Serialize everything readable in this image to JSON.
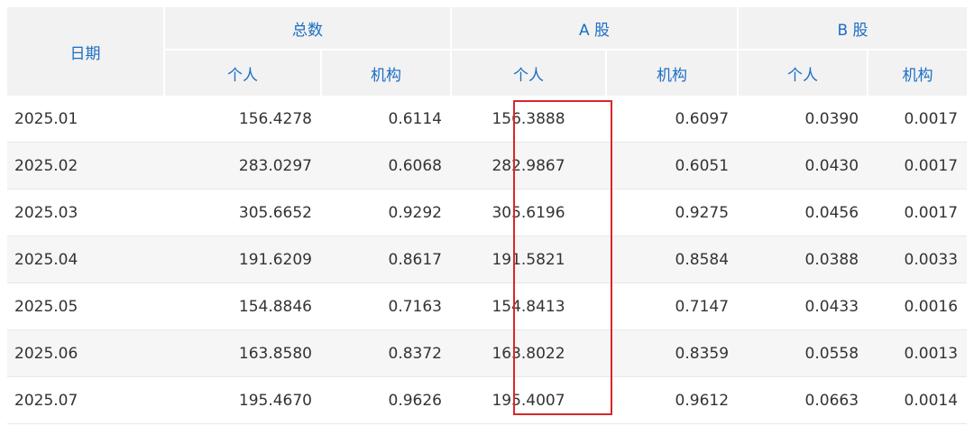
{
  "table": {
    "header": {
      "date": "日期",
      "groups": [
        "总数",
        "A 股",
        "B 股"
      ],
      "sub": [
        "个人",
        "机构",
        "个人",
        "机构",
        "个人",
        "机构"
      ]
    },
    "rows": [
      {
        "date": "2025.01",
        "values": [
          "156.4278",
          "0.6114",
          "156.3888",
          "0.6097",
          "0.0390",
          "0.0017"
        ]
      },
      {
        "date": "2025.02",
        "values": [
          "283.0297",
          "0.6068",
          "282.9867",
          "0.6051",
          "0.0430",
          "0.0017"
        ]
      },
      {
        "date": "2025.03",
        "values": [
          "305.6652",
          "0.9292",
          "305.6196",
          "0.9275",
          "0.0456",
          "0.0017"
        ]
      },
      {
        "date": "2025.04",
        "values": [
          "191.6209",
          "0.8617",
          "191.5821",
          "0.8584",
          "0.0388",
          "0.0033"
        ]
      },
      {
        "date": "2025.05",
        "values": [
          "154.8846",
          "0.7163",
          "154.8413",
          "0.7147",
          "0.0433",
          "0.0016"
        ]
      },
      {
        "date": "2025.06",
        "values": [
          "163.8580",
          "0.8372",
          "163.8022",
          "0.8359",
          "0.0558",
          "0.0013"
        ]
      },
      {
        "date": "2025.07",
        "values": [
          "195.4670",
          "0.9626",
          "195.4007",
          "0.9612",
          "0.0663",
          "0.0014"
        ]
      }
    ]
  },
  "colors": {
    "header_text": "#1a6ec4",
    "header_bg": "#f2f2f2",
    "row_alt_bg": "#f6f6f6",
    "highlight_border": "#d9262c",
    "body_text": "#333333"
  }
}
